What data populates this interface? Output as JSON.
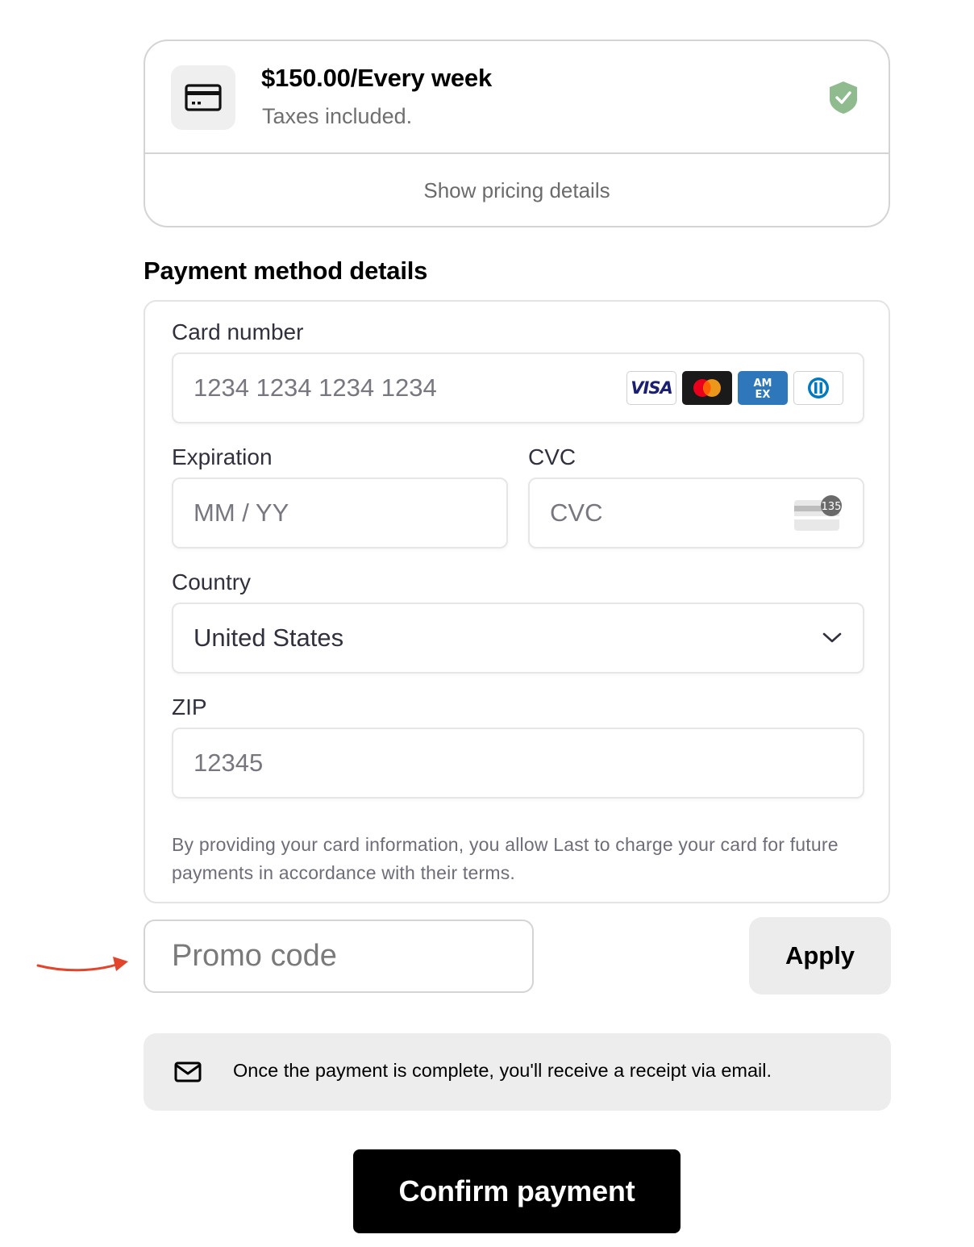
{
  "pricing": {
    "price_text": "$150.00/Every week",
    "tax_note": "Taxes included.",
    "details_link": "Show pricing details"
  },
  "payment": {
    "section_title": "Payment method details",
    "card_number": {
      "label": "Card number",
      "placeholder": "1234 1234 1234 1234"
    },
    "card_brands": [
      "Visa",
      "Mastercard",
      "American Express",
      "Diners Club"
    ],
    "brand_visa_text": "VISA",
    "brand_amex_text": "AM\nEX",
    "expiration": {
      "label": "Expiration",
      "placeholder": "MM / YY"
    },
    "cvc": {
      "label": "CVC",
      "placeholder": "CVC",
      "icon_badge": "135"
    },
    "country": {
      "label": "Country",
      "value": "United States"
    },
    "zip": {
      "label": "ZIP",
      "placeholder": "12345"
    },
    "legal_text": "By providing your card information, you allow Last to charge your card for future payments in accordance with their terms."
  },
  "promo": {
    "placeholder": "Promo code",
    "apply_label": "Apply"
  },
  "receipt_note": "Once the payment is complete, you'll receive a receipt via email.",
  "confirm_label": "Confirm payment",
  "colors": {
    "shield_green": "#8fbb8e",
    "arrow_red": "#e2452b",
    "mastercard_red": "#eb001b",
    "mastercard_orange": "#f79e1b",
    "amex_blue": "#2e77bb",
    "visa_navy": "#1a1f71"
  }
}
